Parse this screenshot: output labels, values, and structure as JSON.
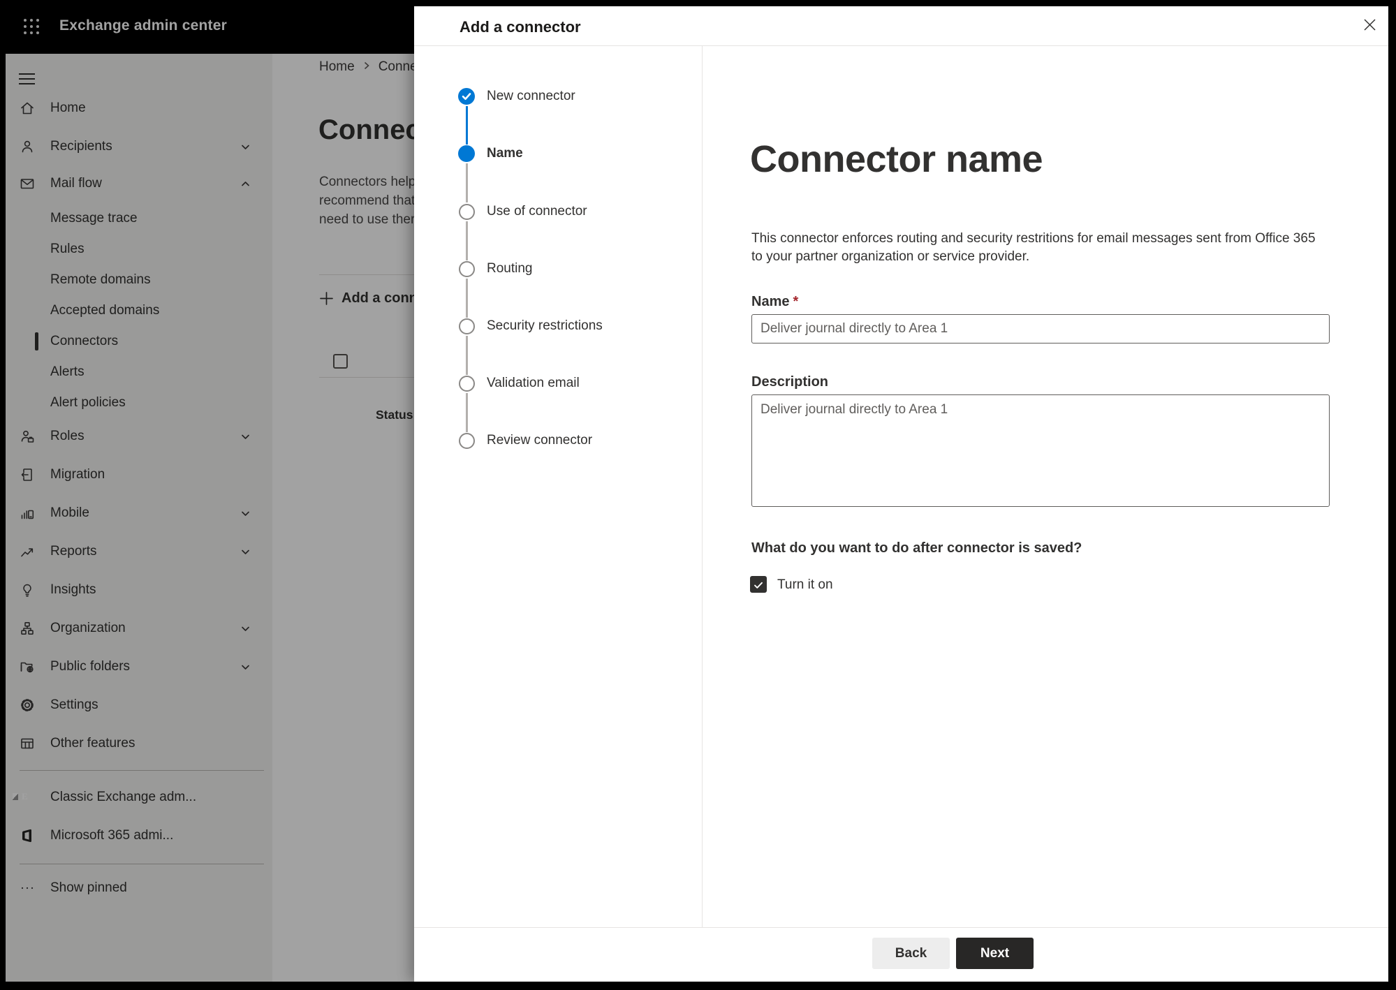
{
  "topbar": {
    "app_title": "Exchange admin center"
  },
  "sidebar": {
    "items": [
      {
        "label": "Home",
        "icon": "home-icon"
      },
      {
        "label": "Recipients",
        "icon": "person-icon",
        "chevron": "down"
      },
      {
        "label": "Mail flow",
        "icon": "mail-icon",
        "chevron": "up",
        "expanded": true
      },
      {
        "label": "Message trace",
        "sub": true
      },
      {
        "label": "Rules",
        "sub": true
      },
      {
        "label": "Remote domains",
        "sub": true
      },
      {
        "label": "Accepted domains",
        "sub": true
      },
      {
        "label": "Connectors",
        "sub": true,
        "selected": true
      },
      {
        "label": "Alerts",
        "sub": true
      },
      {
        "label": "Alert policies",
        "sub": true
      },
      {
        "label": "Roles",
        "icon": "roles-icon",
        "chevron": "down"
      },
      {
        "label": "Migration",
        "icon": "migration-icon"
      },
      {
        "label": "Mobile",
        "icon": "mobile-icon",
        "chevron": "down"
      },
      {
        "label": "Reports",
        "icon": "reports-icon",
        "chevron": "down"
      },
      {
        "label": "Insights",
        "icon": "insights-icon"
      },
      {
        "label": "Organization",
        "icon": "organization-icon",
        "chevron": "down"
      },
      {
        "label": "Public folders",
        "icon": "public-folders-icon",
        "chevron": "down"
      },
      {
        "label": "Settings",
        "icon": "settings-icon"
      },
      {
        "label": "Other features",
        "icon": "other-features-icon"
      },
      {
        "label": "Classic Exchange adm...",
        "icon": "classic-exchange-icon"
      },
      {
        "label": "Microsoft 365 admi...",
        "icon": "microsoft-365-icon"
      },
      {
        "label": "Show pinned",
        "icon": "ellipsis-icon"
      }
    ]
  },
  "background_page": {
    "breadcrumb": {
      "items": [
        "Home",
        "Connectors"
      ]
    },
    "page_title": "Connectors",
    "intro_lines": [
      "Connectors help",
      "recommend that",
      "need to use ther"
    ],
    "add_connector_button": "Add a connector",
    "table_header_status": "Status"
  },
  "dialog": {
    "title": "Add a connector",
    "steps": [
      {
        "label": "New connector",
        "state": "completed"
      },
      {
        "label": "Name",
        "state": "current"
      },
      {
        "label": "Use of connector",
        "state": "upcoming"
      },
      {
        "label": "Routing",
        "state": "upcoming"
      },
      {
        "label": "Security restrictions",
        "state": "upcoming"
      },
      {
        "label": "Validation email",
        "state": "upcoming"
      },
      {
        "label": "Review connector",
        "state": "upcoming"
      }
    ],
    "content": {
      "heading": "Connector name",
      "description_line1": "This connector enforces routing and security restritions for email messages sent from Office 365",
      "description_line2": "to your partner organization or service provider.",
      "name_label": "Name",
      "required_marker": "*",
      "name_value": "Deliver journal directly to Area 1",
      "description_label": "Description",
      "description_value": "Deliver journal directly to Area 1",
      "after_save_question": "What do you want to do after connector is saved?",
      "turn_on_label": "Turn it on",
      "turn_on_checked": true
    },
    "footer": {
      "back_label": "Back",
      "next_label": "Next"
    }
  },
  "colors": {
    "accent": "#0078d4",
    "topbar_bg": "#000000",
    "sidebar_bg": "#f3f2f1",
    "step_line": "#b3b0ad",
    "step_circle_border": "#8a8886",
    "required": "#a4262c",
    "input_border": "#5f5d5b",
    "divider": "#e6e4e2",
    "back_bg": "#ededed",
    "next_bg": "#282726",
    "overlay": "rgba(0,0,0,0.365)"
  }
}
